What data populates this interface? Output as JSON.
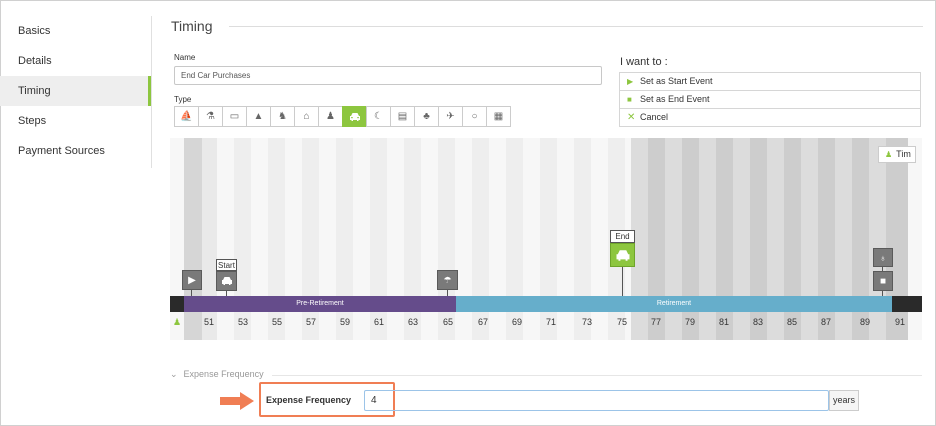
{
  "sidebar": {
    "items": [
      {
        "label": "Basics"
      },
      {
        "label": "Details"
      },
      {
        "label": "Timing"
      },
      {
        "label": "Steps"
      },
      {
        "label": "Payment Sources"
      }
    ],
    "active": "Timing"
  },
  "header": {
    "title": "Timing"
  },
  "name_field": {
    "label": "Name",
    "value": "End Car Purchases"
  },
  "type_field": {
    "label": "Type",
    "icons": [
      "sailboat-icon",
      "flask-icon",
      "book-icon",
      "graduation-cap-icon",
      "rocking-horse-icon",
      "house-icon",
      "bottle-icon",
      "car-icon",
      "moon-icon",
      "store-icon",
      "family-icon",
      "plane-icon",
      "ring-icon",
      "calendar-icon"
    ],
    "selected": "car-icon"
  },
  "want_to": {
    "title": "I want to :",
    "options": [
      {
        "label": "Set as Start Event",
        "icon": "triangle-right-icon"
      },
      {
        "label": "Set as End Event",
        "icon": "square-icon"
      },
      {
        "label": "Cancel",
        "icon": "x-icon"
      }
    ]
  },
  "timeline": {
    "person": "Tim",
    "ages": [
      "51",
      "53",
      "55",
      "57",
      "59",
      "61",
      "63",
      "65",
      "67",
      "69",
      "71",
      "73",
      "75",
      "77",
      "79",
      "81",
      "83",
      "85",
      "87",
      "89",
      "91"
    ],
    "phases": {
      "pre": "Pre-Retirement",
      "ret": "Retirement"
    },
    "markers": {
      "start_tag": "Start",
      "end_tag": "End"
    }
  },
  "expense_frequency": {
    "section_title": "Expense Frequency",
    "label": "Expense Frequency",
    "value": "4",
    "unit": "years"
  },
  "colors": {
    "accent": "#8dc63f",
    "pre": "#654c8b",
    "ret": "#66aecb",
    "highlight": "#f07e54"
  }
}
